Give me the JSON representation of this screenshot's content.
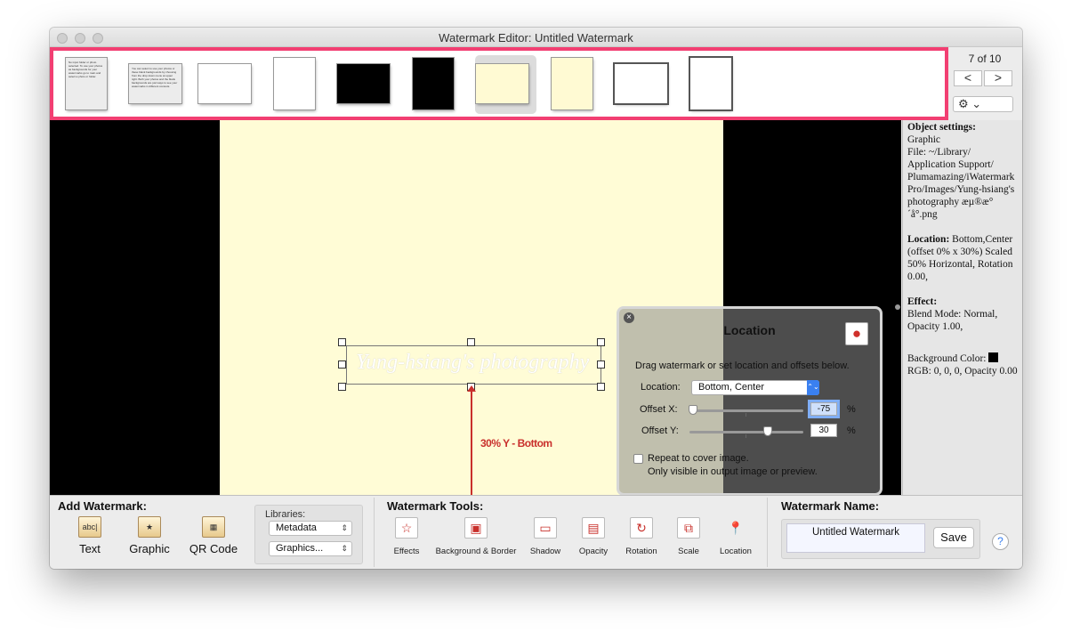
{
  "window": {
    "title": "Watermark Editor: Untitled Watermark"
  },
  "thumbnails": {
    "t1_text": "No input folder or photo selected. To use your photos as backgrounds for your watermarks go to main and select a photo or folder.",
    "t2_text": "You can select to use your photos or these blank backgrounds by choosing from the drop down menu at upper right. Both your photos and the blank backgrounds are just ways to see your watermarks in different contexts.",
    "colors": {
      "white": "#ffffff",
      "black": "#000000",
      "cream": "#fffad3",
      "highlight": "#f23f72"
    }
  },
  "pager": {
    "label": "7 of 10",
    "prev": "<",
    "next": ">"
  },
  "gear": {
    "icon": "gear-icon",
    "label": "⚙ ⌄"
  },
  "canvas": {
    "watermark_text": "Yung-hsiang's photography",
    "offset_label": "30% Y - Bottom"
  },
  "object_settings": {
    "heading": "Object settings:",
    "type": "Graphic",
    "file": "File: ~/Library/ Application Support/ Plumamazing/iWatermark Pro/Images/Yung-hsiang's photography æµ®æ° ´å°.png",
    "location_heading": "Location:",
    "location": "Bottom,Center (offset 0% x 30%) Scaled 50% Horizontal, Rotation 0.00,",
    "effect_heading": "Effect:",
    "effect": "Blend Mode: Normal, Opacity 1.00,",
    "bg_heading": "Background Color:",
    "bg": "RGB: 0, 0, 0, Opacity 0.00"
  },
  "popover": {
    "title": "Location",
    "close": "×",
    "pin_icon": "map-pin-icon",
    "description": "Drag watermark or set location and offsets below.",
    "location_label": "Location:",
    "location_value": "Bottom, Center",
    "offset_x_label": "Offset X:",
    "offset_x_value": "-75",
    "offset_y_label": "Offset Y:",
    "offset_y_value": "30",
    "percent": "%",
    "repeat_label": "Repeat to cover image.",
    "repeat_note": "Only visible in output  image or preview.",
    "repeat_checked": false
  },
  "add_watermark": {
    "title": "Add Watermark:",
    "items": [
      {
        "label": "Text",
        "icon": "text-icon",
        "glyph": "abc|"
      },
      {
        "label": "Graphic",
        "icon": "graphic-icon",
        "glyph": "★"
      },
      {
        "label": "QR Code",
        "icon": "qr-code-icon",
        "glyph": "▦"
      }
    ]
  },
  "libraries": {
    "title": "Libraries:",
    "metadata": "Metadata",
    "graphics": "Graphics..."
  },
  "tools": {
    "title": "Watermark Tools:",
    "items": [
      {
        "label": "Effects",
        "glyph": "☆"
      },
      {
        "label": "Background & Border",
        "glyph": "▣"
      },
      {
        "label": "Shadow",
        "glyph": "▭"
      },
      {
        "label": "Opacity",
        "glyph": "▤"
      },
      {
        "label": "Rotation",
        "glyph": "↻"
      },
      {
        "label": "Scale",
        "glyph": "⧉"
      },
      {
        "label": "Location",
        "glyph": "📍"
      }
    ]
  },
  "name": {
    "title": "Watermark Name:",
    "value": "Untitled Watermark",
    "save": "Save",
    "help": "?"
  }
}
